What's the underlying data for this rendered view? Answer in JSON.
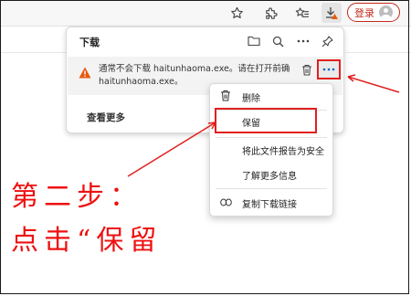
{
  "toolbar": {
    "login_label": "登录",
    "icons": [
      "star-icon",
      "extensions-icon",
      "favorites-icon",
      "downloads-icon",
      "avatar"
    ]
  },
  "downloads_panel": {
    "title": "下载",
    "header_icons": [
      "folder-icon",
      "search-icon",
      "more-icon",
      "pin-icon"
    ],
    "item": {
      "status_icon": "warning-icon",
      "message_line1": "通常不会下载 haitunhaoma.exe。请在打开前确",
      "message_line2": "haitunhaoma.exe。"
    },
    "see_more_label": "查看更多"
  },
  "context_menu": {
    "items": [
      {
        "label": "删除",
        "icon": "trash-icon"
      },
      {
        "label": "保留",
        "icon": ""
      },
      {
        "label": "将此文件报告为安全",
        "icon": ""
      },
      {
        "label": "了解更多信息",
        "icon": ""
      },
      {
        "label": "复制下载链接",
        "icon": "link-icon"
      }
    ]
  },
  "annotation": {
    "step_title": "第二步：",
    "step_desc": "点击“保留"
  },
  "colors": {
    "annotation_red": "#ee1111",
    "highlight_red": "#e0201e",
    "warning_orange": "#e8590c",
    "login_red": "#c42b1c",
    "accent_blue": "#0067c0"
  }
}
